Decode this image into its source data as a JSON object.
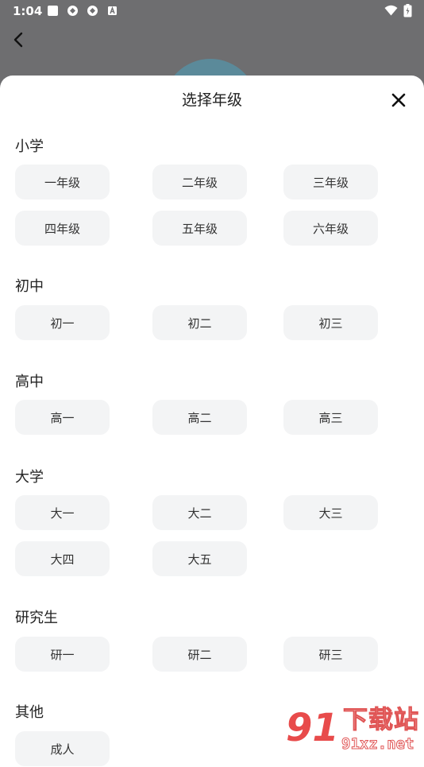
{
  "status_bar": {
    "time": "1:04"
  },
  "sheet": {
    "title": "选择年级"
  },
  "sections": [
    {
      "title": "小学",
      "grades": [
        "一年级",
        "二年级",
        "三年级",
        "四年级",
        "五年级",
        "六年级"
      ]
    },
    {
      "title": "初中",
      "grades": [
        "初一",
        "初二",
        "初三"
      ]
    },
    {
      "title": "高中",
      "grades": [
        "高一",
        "高二",
        "高三"
      ]
    },
    {
      "title": "大学",
      "grades": [
        "大一",
        "大二",
        "大三",
        "大四",
        "大五"
      ]
    },
    {
      "title": "研究生",
      "grades": [
        "研一",
        "研二",
        "研三"
      ]
    },
    {
      "title": "其他",
      "grades": [
        "成人"
      ]
    }
  ],
  "watermark": {
    "logo": "91",
    "line1": "下载站",
    "line2": "91xz.net"
  },
  "colors": {
    "chip_bg": "#f3f4f5",
    "overlay": "#6e6e70",
    "watermark": "#e84b4b"
  }
}
